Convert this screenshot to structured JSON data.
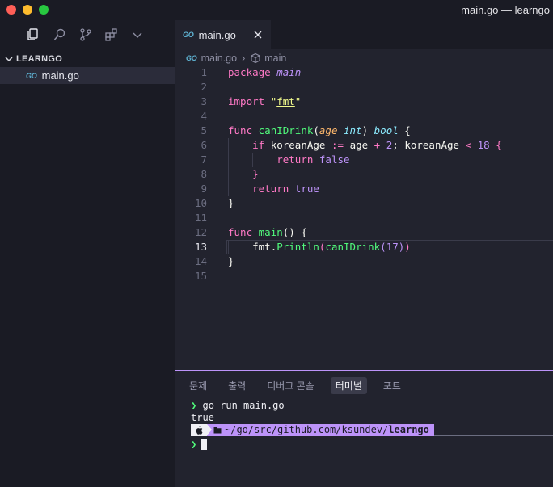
{
  "window": {
    "title": "main.go — learngo"
  },
  "activity": {
    "icons": [
      "files-icon",
      "search-icon",
      "source-control-icon",
      "extensions-icon",
      "chevron-down-icon"
    ]
  },
  "sidebar": {
    "folder": "LEARNGO",
    "files": [
      {
        "icon": "GO",
        "label": "main.go"
      }
    ]
  },
  "editor": {
    "tab": {
      "icon": "GO",
      "label": "main.go"
    },
    "breadcrumb": {
      "file_icon": "GO",
      "file": "main.go",
      "symbol": "main"
    },
    "active_line": 13
  },
  "panel": {
    "tabs": [
      "문제",
      "출력",
      "디버그 콘솔",
      "터미널",
      "포트"
    ],
    "active_tab": "터미널",
    "terminal": {
      "prompt": "❯",
      "command": "go run main.go",
      "output": "true",
      "path_prefix": "~/go/src/github.com/ksundev/",
      "path_dir": "learngo"
    }
  },
  "colors": {
    "accent": "#bd93f9",
    "keyword": "#ff79c6",
    "function": "#50fa7b",
    "type": "#8be9fd",
    "string": "#f1fa8c",
    "parameter": "#ffb86c"
  }
}
